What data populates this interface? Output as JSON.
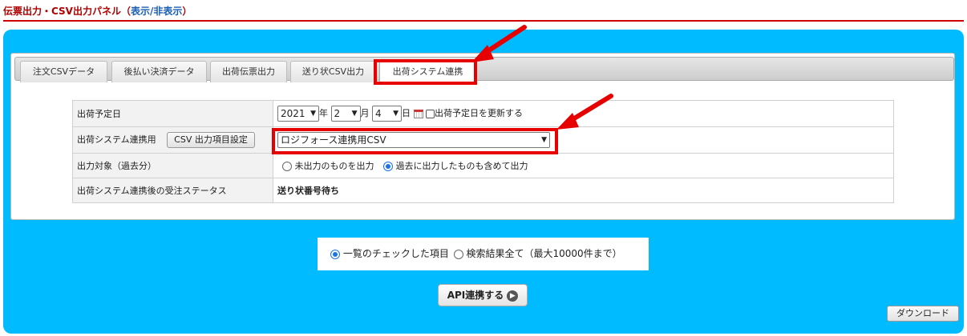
{
  "panel_title": {
    "main": "伝票出力・CSV出力パネル",
    "open_paren": "（",
    "show_link": "表示",
    "slash": "/",
    "hide_link": "非表示",
    "close_paren": "）"
  },
  "tabs": [
    {
      "label": "注文CSVデータ"
    },
    {
      "label": "後払い決済データ"
    },
    {
      "label": "出荷伝票出力"
    },
    {
      "label": "送り状CSV出力"
    },
    {
      "label": "出荷システム連携",
      "active": true
    }
  ],
  "form": {
    "ship_date": {
      "label": "出荷予定日",
      "year": "2021",
      "year_suffix": "年",
      "month": "2",
      "month_suffix": "月",
      "day": "4",
      "day_suffix": "日",
      "update_checkbox_label": "出荷予定日を更新する"
    },
    "ship_system": {
      "label": "出荷システム連携用",
      "csv_settings_button": "CSV 出力項目設定",
      "selected": "ロジフォース連携用CSV"
    },
    "output_target": {
      "label": "出力対象（過去分）",
      "option_unexported": "未出力のものを出力",
      "option_include_past": "過去に出力したものも含めて出力",
      "selected": "option_include_past"
    },
    "status_after": {
      "label": "出荷システム連携後の受注ステータス",
      "value": "送り状番号待ち"
    }
  },
  "scope": {
    "option_checked": "一覧のチェックした項目",
    "option_all": "検索結果全て（最大10000件まで）",
    "selected": "option_checked"
  },
  "api_button_label": "API連携する",
  "download_button_label": "ダウンロード",
  "colors": {
    "panel_bg": "#00bbff",
    "title_red": "#b00000",
    "highlight": "#e60000",
    "link_blue": "#1a5fb4"
  }
}
